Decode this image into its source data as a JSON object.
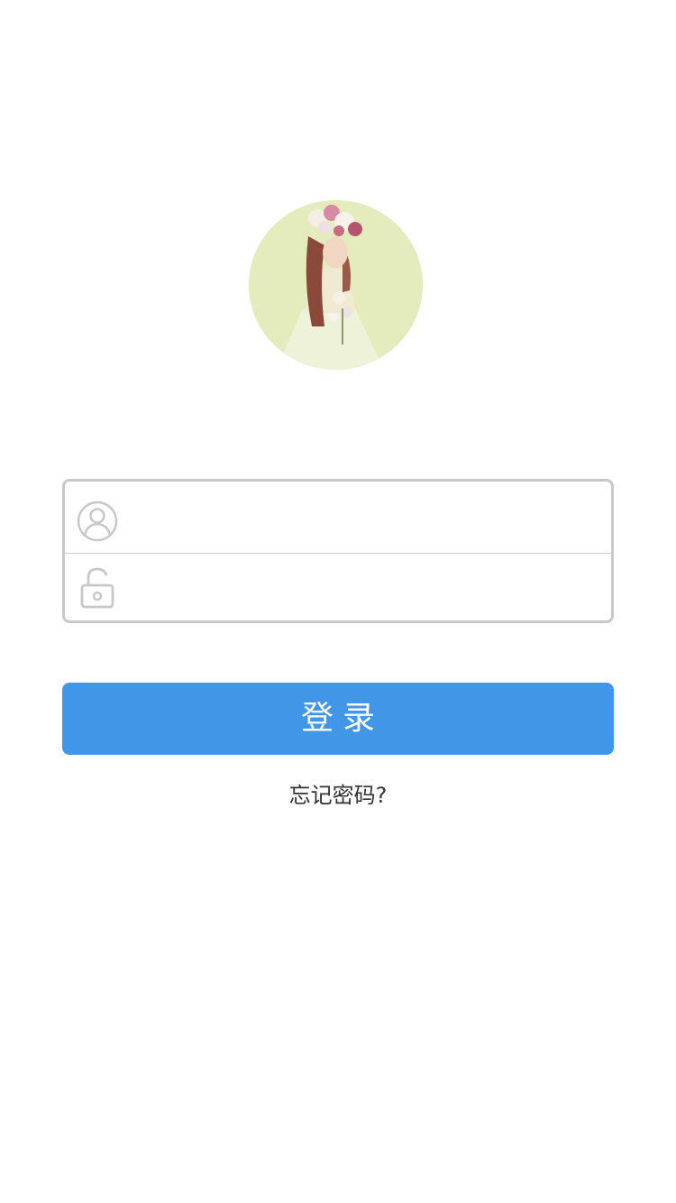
{
  "avatar": {
    "description_icon": "user-avatar-photo"
  },
  "login_form": {
    "username": {
      "icon": "user-icon",
      "value": "",
      "placeholder": ""
    },
    "password": {
      "icon": "unlocked-padlock-icon",
      "value": "",
      "placeholder": ""
    }
  },
  "login_button": {
    "label": "登录"
  },
  "forgot_password": {
    "label": "忘记密码?"
  },
  "colors": {
    "accent": "#4196e8",
    "border": "#c8c8c8",
    "text": "#333333",
    "background": "#ffffff"
  }
}
